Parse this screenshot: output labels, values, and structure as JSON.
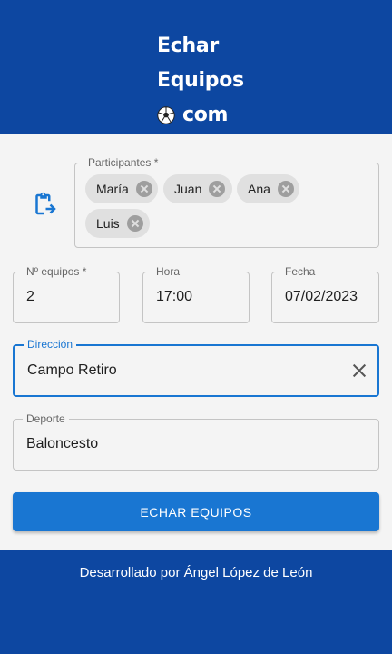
{
  "header": {
    "brand_line1": "Echar",
    "brand_line2": "Equipos",
    "brand_line3": "com",
    "brand_icon": "soccer-ball-icon",
    "background": "#0d47a1"
  },
  "form": {
    "participants": {
      "label": "Participantes *",
      "chips": [
        "María",
        "Juan",
        "Ana",
        "Luis"
      ],
      "icon": "clipboard-arrow-icon"
    },
    "num_teams": {
      "label": "Nº equipos *",
      "value": "2"
    },
    "time": {
      "label": "Hora",
      "value": "17:00"
    },
    "date": {
      "label": "Fecha",
      "value": "07/02/2023"
    },
    "address": {
      "label": "Dirección",
      "value": "Campo Retiro"
    },
    "sport": {
      "label": "Deporte",
      "value": "Baloncesto"
    },
    "submit_label": "ECHAR EQUIPOS"
  },
  "footer": {
    "text": "Desarrollado por Ángel López de León"
  },
  "colors": {
    "primary": "#1976d2",
    "header_footer": "#0d47a1",
    "background": "#f4f4f4"
  }
}
